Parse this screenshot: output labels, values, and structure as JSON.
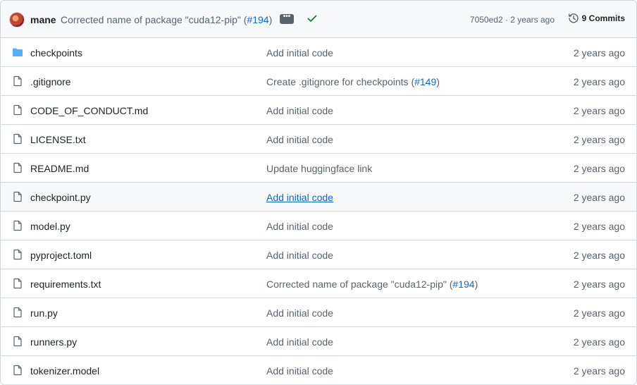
{
  "header": {
    "author": "mane",
    "commit_message": "Corrected name of package \"cuda12-pip\" (",
    "commit_pr": "#194",
    "commit_close": ")",
    "ellipsis": "•••",
    "sha_date": "7050ed2 · 2 years ago",
    "commits_label": "9 Commits"
  },
  "colors": {
    "link": "#0969da",
    "muted": "#59636e",
    "check": "#1a7f37",
    "folder": "#54aeff"
  },
  "rows": [
    {
      "icon": "folder-icon",
      "name": "checkpoints",
      "msg": "Add initial code",
      "pr": "",
      "close": "",
      "date": "2 years ago"
    },
    {
      "icon": "file-icon",
      "name": ".gitignore",
      "msg": "Create .gitignore for checkpoints (",
      "pr": "#149",
      "close": ")",
      "date": "2 years ago"
    },
    {
      "icon": "file-icon",
      "name": "CODE_OF_CONDUCT.md",
      "msg": "Add initial code",
      "pr": "",
      "close": "",
      "date": "2 years ago"
    },
    {
      "icon": "file-icon",
      "name": "LICENSE.txt",
      "msg": "Add initial code",
      "pr": "",
      "close": "",
      "date": "2 years ago"
    },
    {
      "icon": "file-icon",
      "name": "README.md",
      "msg": "Update huggingface link",
      "pr": "",
      "close": "",
      "date": "2 years ago"
    },
    {
      "icon": "file-icon",
      "name": "checkpoint.py",
      "msg": "Add initial code",
      "pr": "",
      "close": "",
      "date": "2 years ago"
    },
    {
      "icon": "file-icon",
      "name": "model.py",
      "msg": "Add initial code",
      "pr": "",
      "close": "",
      "date": "2 years ago"
    },
    {
      "icon": "file-icon",
      "name": "pyproject.toml",
      "msg": "Add initial code",
      "pr": "",
      "close": "",
      "date": "2 years ago"
    },
    {
      "icon": "file-icon",
      "name": "requirements.txt",
      "msg": "Corrected name of package \"cuda12-pip\" (",
      "pr": "#194",
      "close": ")",
      "date": "2 years ago"
    },
    {
      "icon": "file-icon",
      "name": "run.py",
      "msg": "Add initial code",
      "pr": "",
      "close": "",
      "date": "2 years ago"
    },
    {
      "icon": "file-icon",
      "name": "runners.py",
      "msg": "Add initial code",
      "pr": "",
      "close": "",
      "date": "2 years ago"
    },
    {
      "icon": "file-icon",
      "name": "tokenizer.model",
      "msg": "Add initial code",
      "pr": "",
      "close": "",
      "date": "2 years ago"
    }
  ]
}
